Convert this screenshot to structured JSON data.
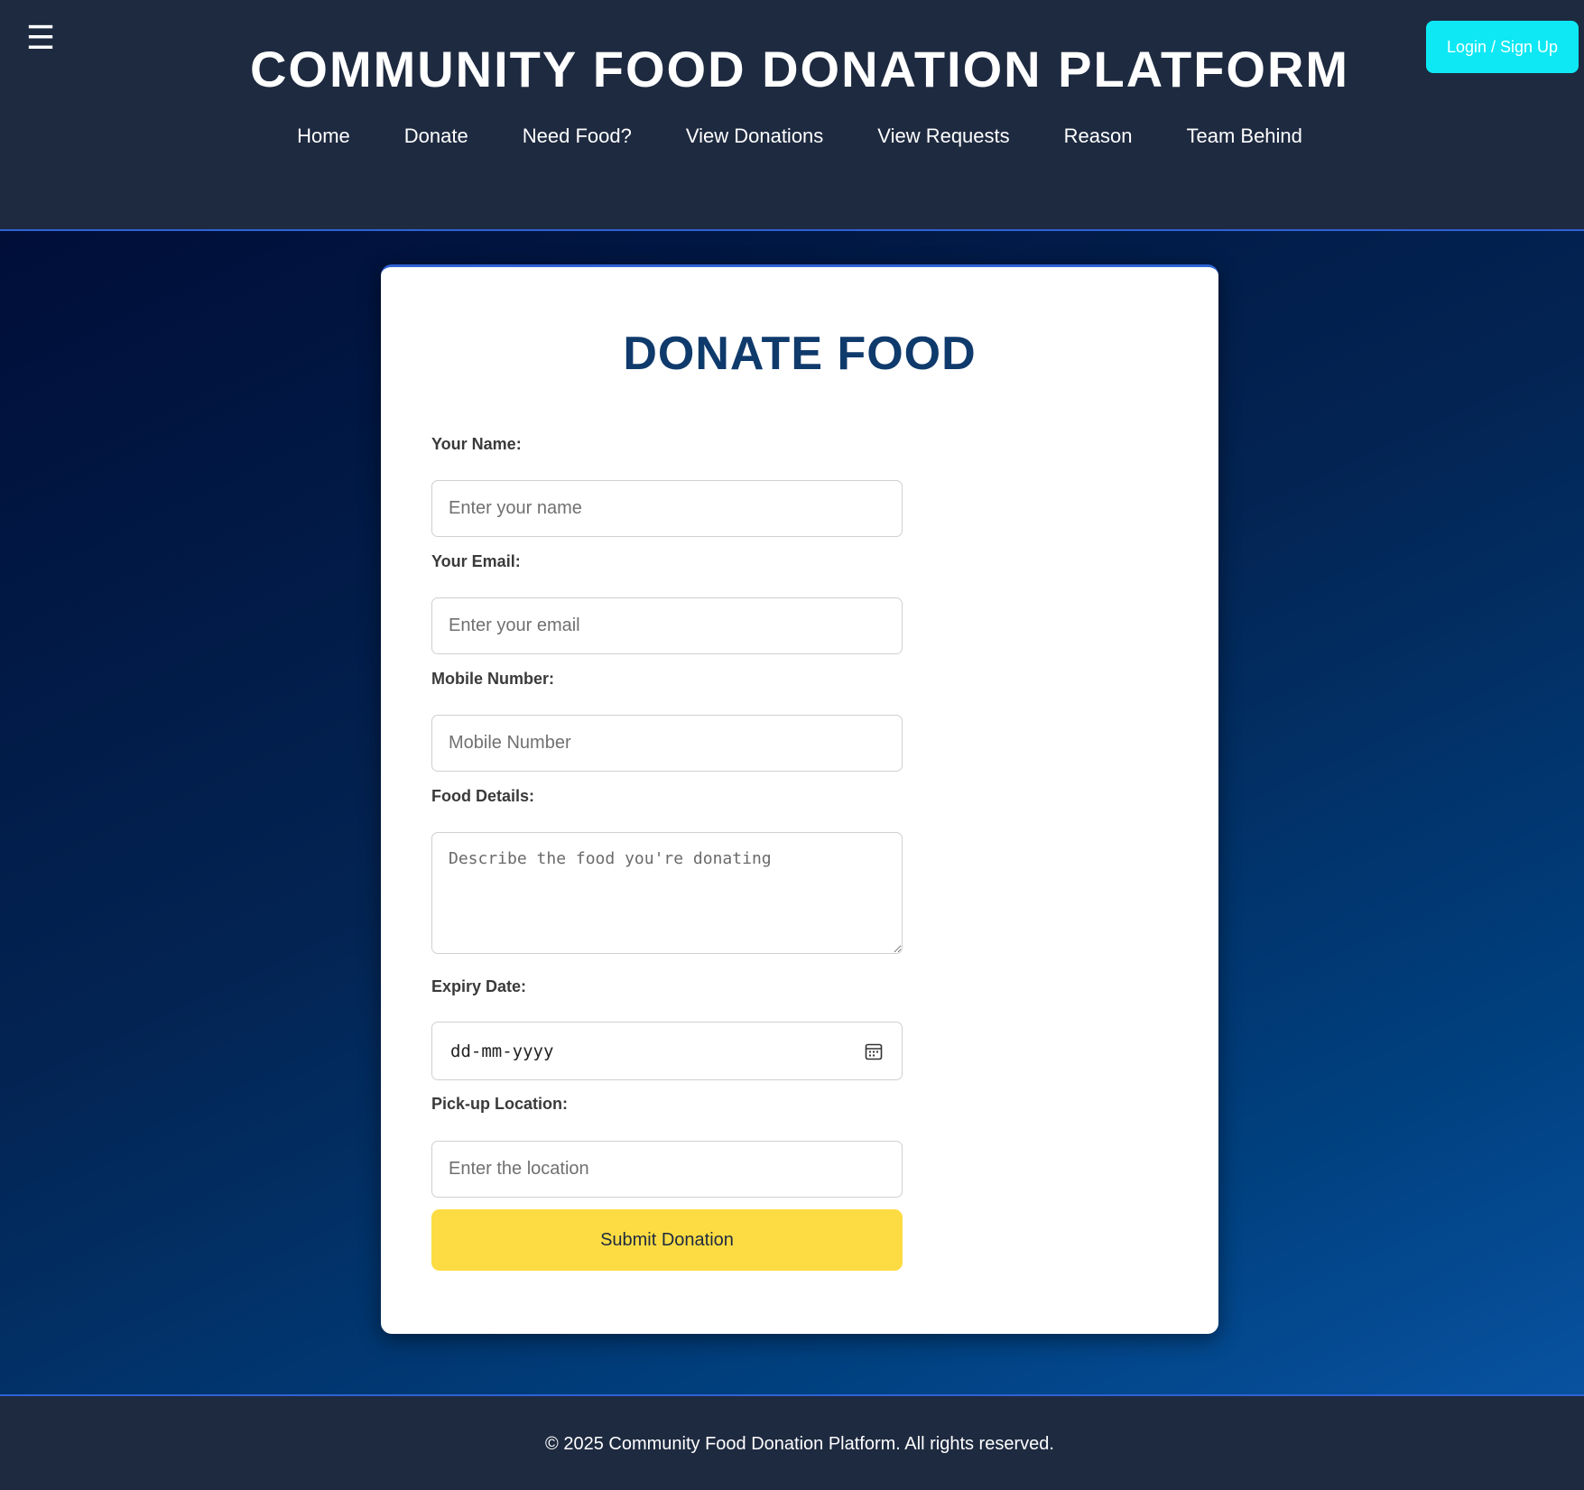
{
  "header": {
    "menu_icon": "☰",
    "title": "COMMUNITY FOOD DONATION PLATFORM",
    "login_label": "Login / Sign Up",
    "nav": [
      "Home",
      "Donate",
      "Need Food?",
      "View Donations",
      "View Requests",
      "Reason",
      "Team Behind"
    ]
  },
  "form": {
    "title": "DONATE FOOD",
    "name": {
      "label": "Your Name:",
      "placeholder": "Enter your name"
    },
    "email": {
      "label": "Your Email:",
      "placeholder": "Enter your email"
    },
    "mobile": {
      "label": "Mobile Number:",
      "placeholder": "Mobile Number"
    },
    "food": {
      "label": "Food Details:",
      "placeholder": "Describe the food you're donating"
    },
    "expiry": {
      "label": "Expiry Date:",
      "placeholder": "dd-mm-yyyy"
    },
    "location": {
      "label": "Pick-up Location:",
      "placeholder": "Enter the location"
    },
    "submit_label": "Submit Donation"
  },
  "footer": {
    "text": "© 2025 Community Food Donation Platform. All rights reserved."
  },
  "colors": {
    "header_bg": "#1e2a40",
    "accent_line": "#2f62d6",
    "login_bg": "#0de8f4",
    "title_blue": "#0f3a6c",
    "submit_bg": "#fddc43"
  }
}
